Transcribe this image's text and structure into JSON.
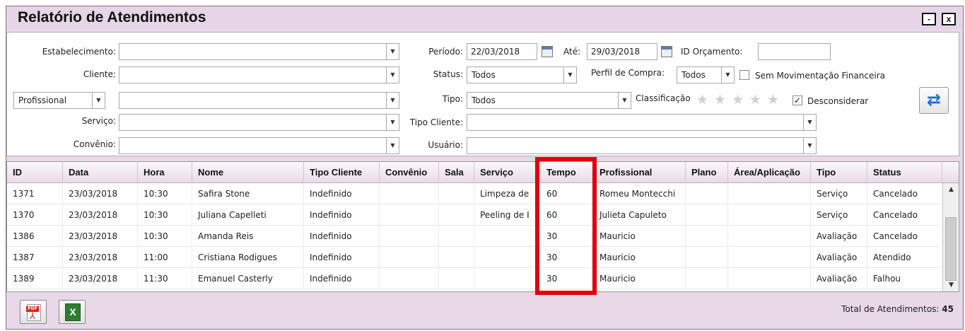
{
  "window": {
    "title": "Relatório de Atendimentos",
    "minimize_label": "-",
    "close_label": "x"
  },
  "filters": {
    "estabelecimento_label": "Estabelecimento:",
    "cliente_label": "Cliente:",
    "profissional_select": "Profissional",
    "servico_label": "Serviço:",
    "convenio_label": "Convênio:",
    "periodo_label": "Período:",
    "periodo_from": "22/03/2018",
    "ate_label": "Até:",
    "periodo_to": "29/03/2018",
    "id_orcamento_label": "ID Orçamento:",
    "status_label": "Status:",
    "status_value": "Todos",
    "perfil_label": "Perfil de Compra:",
    "perfil_value": "Todos",
    "sem_mov_label": "Sem Movimentação Financeira",
    "sem_mov_checked": false,
    "tipo_label": "Tipo:",
    "tipo_value": "Todos",
    "classificacao_label": "Classificação",
    "classificacao_stars": 0,
    "desconsiderar_label": "Desconsiderar",
    "desconsiderar_checked": true,
    "check_mark": "✓",
    "tipo_cliente_label": "Tipo Cliente:",
    "usuario_label": "Usuário:",
    "dropdown_arrow": "▼",
    "refresh_icon": "refresh-icon",
    "refresh_glyph": "⇄"
  },
  "grid": {
    "columns": [
      "ID",
      "Data",
      "Hora",
      "Nome",
      "Tipo Cliente",
      "Convênio",
      "Sala",
      "Serviço",
      "Tempo",
      "Profissional",
      "Plano",
      "Área/Aplicação",
      "Tipo",
      "Status"
    ],
    "rows": [
      [
        "1371",
        "23/03/2018",
        "10:30",
        "Safira Stone",
        "Indefinido",
        "",
        "",
        "Limpeza de",
        "60",
        "Romeu Montecchi",
        "",
        "",
        "Serviço",
        "Cancelado"
      ],
      [
        "1370",
        "23/03/2018",
        "10:30",
        "Juliana Capelleti",
        "Indefinido",
        "",
        "",
        "Peeling de I",
        "60",
        "Julieta Capuleto",
        "",
        "",
        "Serviço",
        "Cancelado"
      ],
      [
        "1386",
        "23/03/2018",
        "10:30",
        "Amanda Reis",
        "Indefinido",
        "",
        "",
        "",
        "30",
        "Mauricio",
        "",
        "",
        "Avaliação",
        "Cancelado"
      ],
      [
        "1387",
        "23/03/2018",
        "11:00",
        "Cristiana Rodigues",
        "Indefinido",
        "",
        "",
        "",
        "30",
        "Mauricio",
        "",
        "",
        "Avaliação",
        "Atendido"
      ],
      [
        "1389",
        "23/03/2018",
        "11:30",
        "Emanuel Casterly",
        "Indefinido",
        "",
        "",
        "",
        "30",
        "Mauricio",
        "",
        "",
        "Avaliação",
        "Falhou"
      ]
    ],
    "scroll_up": "▲",
    "scroll_down": "▼",
    "highlight_color": "#e0000b"
  },
  "footer": {
    "pdf_tag": "PDF",
    "pdf_symbol": "⅄",
    "excel_letter": "X",
    "total_label": "Total de Atendimentos:",
    "total_value": "45"
  }
}
